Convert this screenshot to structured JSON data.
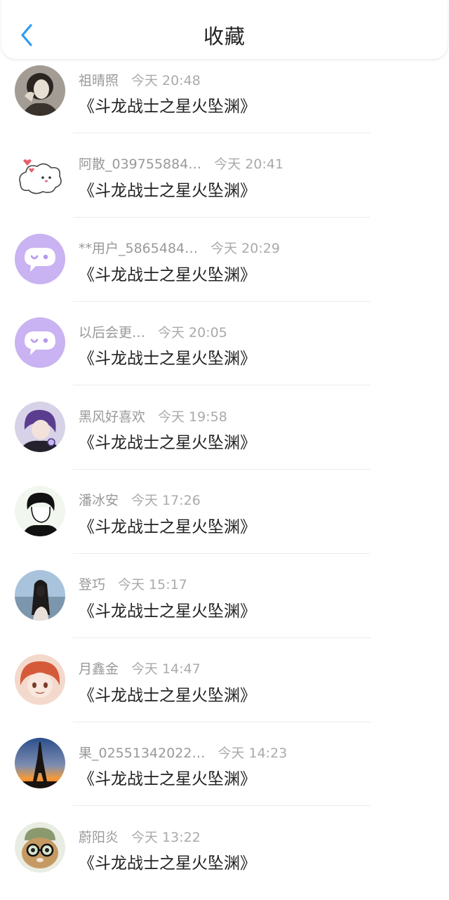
{
  "header": {
    "title": "收藏",
    "back_icon": "chevron-left-icon",
    "accent_color": "#2f9bf0"
  },
  "favorites": [
    {
      "user": "祖晴照",
      "time": "今天 20:48",
      "work": "《斗龙战士之星火坠渊》",
      "avatar": "portrait-vintage"
    },
    {
      "user": "阿散_039755884…",
      "time": "今天 20:41",
      "work": "《斗龙战士之星火坠渊》",
      "avatar": "cartoon-puppy"
    },
    {
      "user": "**用户_5865484…",
      "time": "今天 20:29",
      "work": "《斗龙战士之星火坠渊》",
      "avatar": "default-chat-bubble"
    },
    {
      "user": "以后会更…",
      "time": "今天 20:05",
      "work": "《斗龙战士之星火坠渊》",
      "avatar": "default-chat-bubble"
    },
    {
      "user": "黑风好喜欢",
      "time": "今天 19:58",
      "work": "《斗龙战士之星火坠渊》",
      "avatar": "anime-purple-hair"
    },
    {
      "user": "潘冰安",
      "time": "今天 17:26",
      "work": "《斗龙战士之星火坠渊》",
      "avatar": "line-art-boy"
    },
    {
      "user": "登巧",
      "time": "今天 15:17",
      "work": "《斗龙战士之星火坠渊》",
      "avatar": "girl-by-sea"
    },
    {
      "user": "月鑫金",
      "time": "今天 14:47",
      "work": "《斗龙战士之星火坠渊》",
      "avatar": "anime-red-hair"
    },
    {
      "user": "果_02551342022…",
      "time": "今天 14:23",
      "work": "《斗龙战士之星火坠渊》",
      "avatar": "eiffel-sunset"
    },
    {
      "user": "蔚阳炎",
      "time": "今天 13:22",
      "work": "《斗龙战士之星火坠渊》",
      "avatar": "cat-with-glasses"
    }
  ]
}
